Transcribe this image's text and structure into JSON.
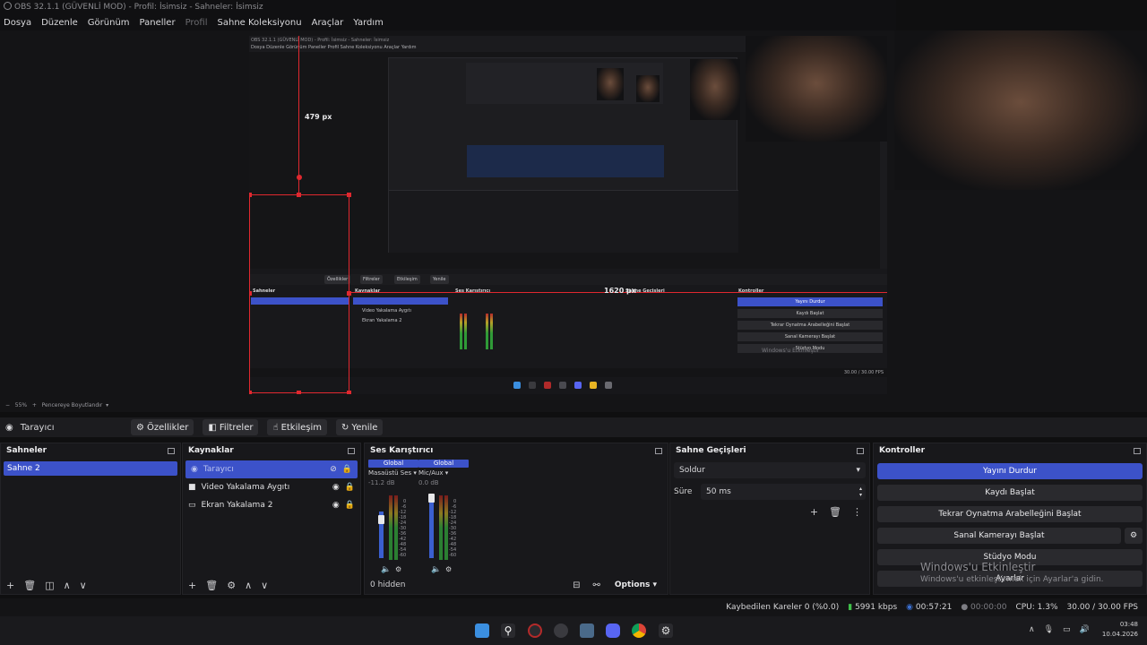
{
  "window": {
    "title": "OBS 32.1.1 (GÜVENLİ MOD) - Profil: İsimsiz - Sahneler: İsimsiz"
  },
  "menu": [
    "Dosya",
    "Düzenle",
    "Görünüm",
    "Paneller",
    "Profil",
    "Sahne Koleksiyonu",
    "Araçlar",
    "Yardım"
  ],
  "preview": {
    "label_height": "479 px",
    "label_width": "1620 px",
    "zoom": "55%",
    "fit_label": "Pencereye Boyutlandır",
    "nested_menu": "Dosya  Düzenle  Görünüm  Paneller  Profil  Sahne Koleksiyonu  Araçlar  Yardım"
  },
  "source_toolbar": {
    "source_name": "Tarayıcı",
    "properties": "Özellikler",
    "filters": "Filtreler",
    "interact": "Etkileşim",
    "refresh": "Yenile"
  },
  "scenes": {
    "title": "Sahneler",
    "items": [
      "Sahne 2"
    ]
  },
  "sources": {
    "title": "Kaynaklar",
    "items": [
      {
        "name": "Tarayıcı",
        "icon": "globe-icon"
      },
      {
        "name": "Video Yakalama Aygıtı",
        "icon": "camera-icon"
      },
      {
        "name": "Ekran Yakalama 2",
        "icon": "monitor-icon"
      }
    ]
  },
  "mixer": {
    "title": "Ses Karıştırıcı",
    "channels": [
      {
        "scope": "Global",
        "name": "Masaüstü Ses",
        "db": "-11.2 dB"
      },
      {
        "scope": "Global",
        "name": "Mic/Aux",
        "db": "0.0 dB"
      }
    ],
    "scale": [
      "0",
      "-6",
      "-12",
      "-18",
      "-24",
      "-30",
      "-36",
      "-42",
      "-48",
      "-54",
      "-60"
    ],
    "hidden": "0 hidden",
    "options": "Options"
  },
  "transitions": {
    "title": "Sahne Geçişleri",
    "selected": "Soldur",
    "duration_label": "Süre",
    "duration_value": "50 ms"
  },
  "controls": {
    "title": "Kontroller",
    "buttons": [
      "Yayını Durdur",
      "Kaydı Başlat",
      "Tekrar Oynatma Arabelleğini Başlat",
      "Sanal Kamerayı Başlat",
      "Stüdyo Modu",
      "Ayarlar"
    ]
  },
  "status": {
    "dropped": "Kaybedilen Kareler 0 (%0.0)",
    "bitrate": "5991 kbps",
    "stream_time": "00:57:21",
    "record_time": "00:00:00",
    "cpu": "CPU: 1.3%",
    "fps": "30.00 / 30.00 FPS"
  },
  "watermark": {
    "line1": "Windows'u Etkinleştir",
    "line2": "Windows'u etkinleştirmek için Ayarlar'a gidin."
  },
  "clock": {
    "time": "03:48",
    "date": "10.04.2026"
  },
  "colors": {
    "accent": "#3c52c9",
    "guide": "#e0282f",
    "panel": "#18181b"
  }
}
